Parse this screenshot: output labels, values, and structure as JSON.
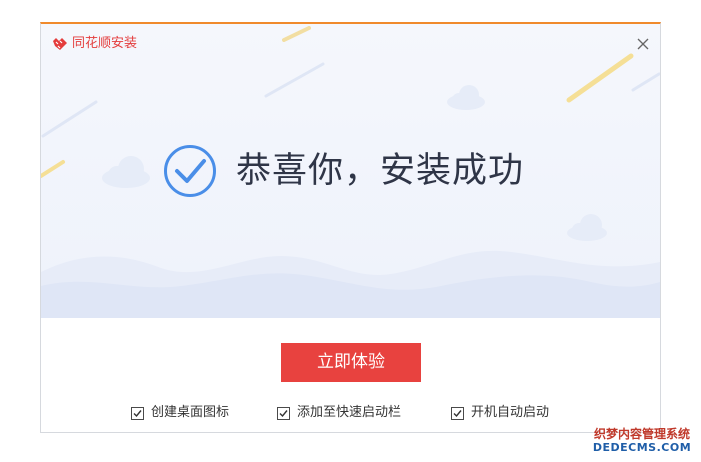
{
  "window": {
    "title": "同花顺安装",
    "accent_color": "#f08a2c",
    "title_color": "#e43c3c",
    "close_icon": "close-icon",
    "logo_icon": "app-logo-icon"
  },
  "hero": {
    "message": "恭喜你，安装成功",
    "status_icon": "check-circle-icon",
    "icon_color": "#4a8ee8"
  },
  "actions": {
    "primary_label": "立即体验",
    "primary_color": "#e8423f"
  },
  "options": [
    {
      "label": "创建桌面图标",
      "checked": true
    },
    {
      "label": "添加至快速启动栏",
      "checked": true
    },
    {
      "label": "开机自动启动",
      "checked": true
    }
  ],
  "watermark": {
    "line1": "织梦内容管理系统",
    "line2": "DEDECMS.COM"
  }
}
